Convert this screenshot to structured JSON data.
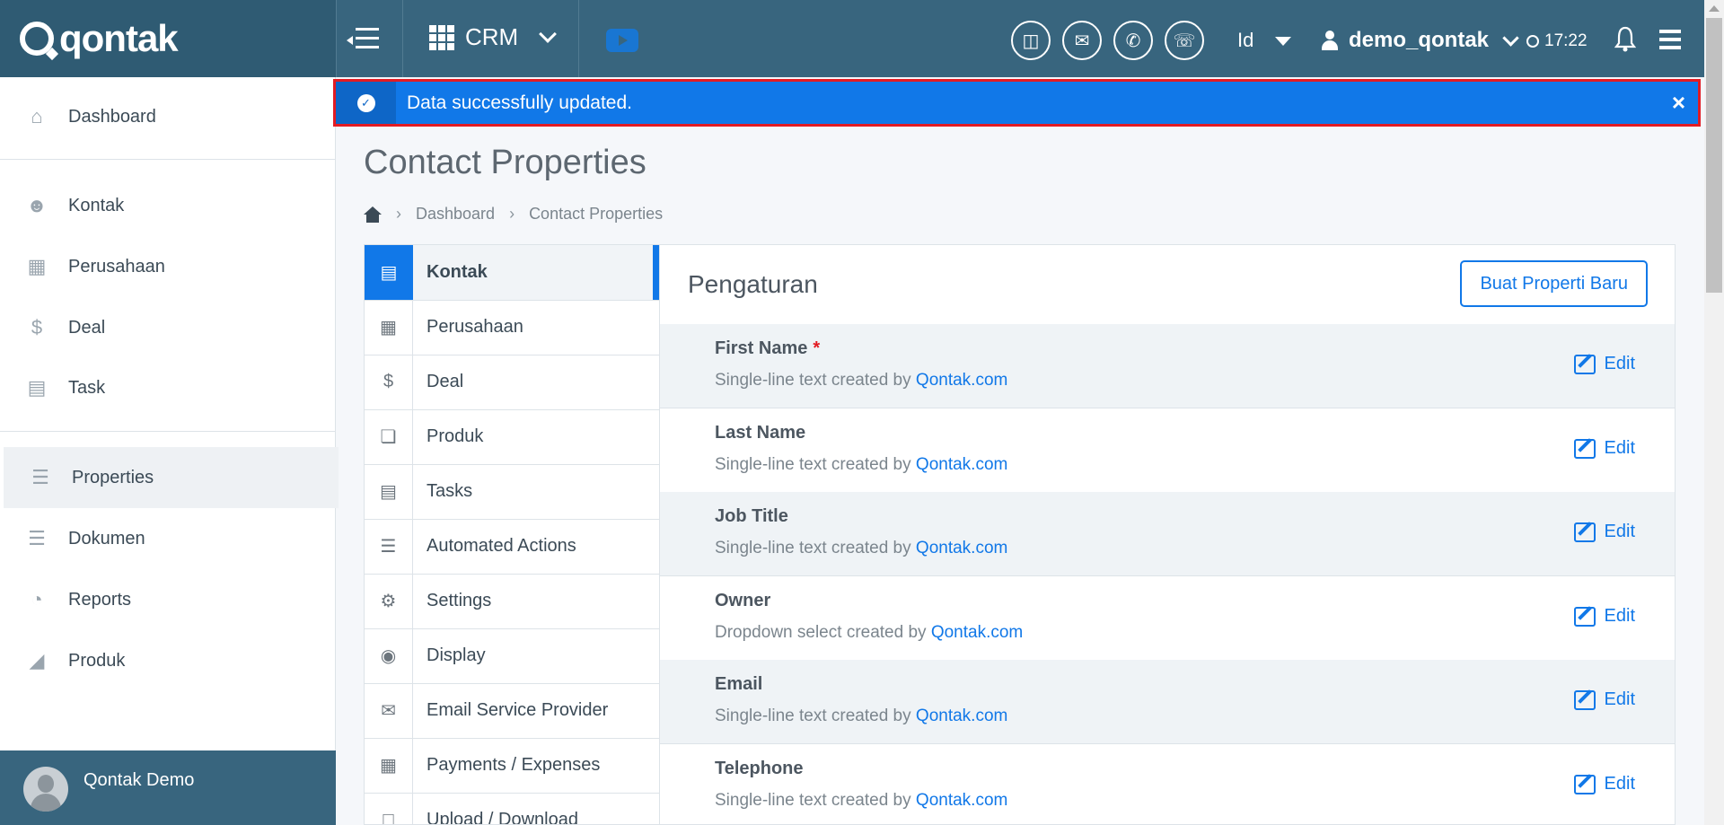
{
  "header": {
    "logo": "qontak",
    "app_switcher": "CRM",
    "language": "Id",
    "username": "demo_qontak",
    "time": "17:22"
  },
  "sidebar": {
    "items": [
      {
        "label": "Dashboard",
        "icon": "home-icon"
      },
      {
        "label": "Kontak",
        "icon": "people-icon"
      },
      {
        "label": "Perusahaan",
        "icon": "building-icon"
      },
      {
        "label": "Deal",
        "icon": "dollar-icon"
      },
      {
        "label": "Task",
        "icon": "calendar-icon"
      },
      {
        "label": "Properties",
        "icon": "list-icon",
        "active": true
      },
      {
        "label": "Dokumen",
        "icon": "layers-icon"
      },
      {
        "label": "Reports",
        "icon": "pie-chart-icon"
      },
      {
        "label": "Produk",
        "icon": "tag-icon"
      }
    ],
    "footer_name": "Qontak Demo"
  },
  "alert": {
    "message": "Data successfully updated.",
    "close": "×"
  },
  "page": {
    "title": "Contact Properties",
    "breadcrumb": [
      "Dashboard",
      "Contact Properties"
    ]
  },
  "submenu": {
    "items": [
      {
        "label": "Kontak",
        "icon": "contact-card-icon",
        "active": true
      },
      {
        "label": "Perusahaan",
        "icon": "building-icon"
      },
      {
        "label": "Deal",
        "icon": "dollar-icon"
      },
      {
        "label": "Produk",
        "icon": "cubes-icon"
      },
      {
        "label": "Tasks",
        "icon": "calendar-icon"
      },
      {
        "label": "Automated Actions",
        "icon": "server-icon"
      },
      {
        "label": "Settings",
        "icon": "gear-icon"
      },
      {
        "label": "Display",
        "icon": "eye-icon"
      },
      {
        "label": "Email Service Provider",
        "icon": "envelope-icon"
      },
      {
        "label": "Payments / Expenses",
        "icon": "calculator-icon"
      },
      {
        "label": "Upload / Download",
        "icon": "file-icon"
      }
    ]
  },
  "panel": {
    "title": "Pengaturan",
    "new_button": "Buat Properti Baru",
    "edit_label": "Edit",
    "created_by_text": "created by",
    "created_by_link": "Qontak.com",
    "properties": [
      {
        "name": "First Name",
        "required": "*",
        "type": "Single-line text"
      },
      {
        "name": "Last Name",
        "required": "",
        "type": "Single-line text"
      },
      {
        "name": "Job Title",
        "required": "",
        "type": "Single-line text"
      },
      {
        "name": "Owner",
        "required": "",
        "type": "Dropdown select"
      },
      {
        "name": "Email",
        "required": "",
        "type": "Single-line text"
      },
      {
        "name": "Telephone",
        "required": "",
        "type": "Single-line text"
      }
    ]
  },
  "colors": {
    "header_bg": "#38657e",
    "accent_blue": "#1178e8",
    "alert_border": "#e21b23"
  }
}
